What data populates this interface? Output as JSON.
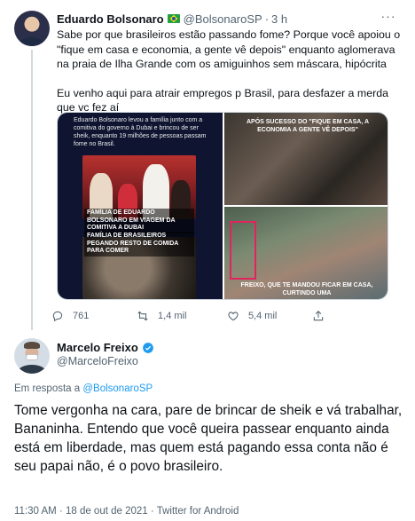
{
  "tweet1": {
    "author_name": "Eduardo Bolsonaro",
    "handle": "@BolsonaroSP",
    "separator": "·",
    "time": "3 h",
    "more": "···",
    "paragraph1": "Sabe por que brasileiros estão passando fome? Porque você apoiou o \"fique em casa e economia, a gente vê depois\" enquanto aglomerava na praia de Ilha Grande com os amiguinhos sem máscara, hipócrita",
    "paragraph2": "Eu venho aqui para atrair empregos p Brasil, para desfazer a merda que vc fez aí",
    "media": {
      "left_caption": "Eduardo Bolsonaro levou a família junto com a comitiva do governo à Dubai e brincou de ser sheik, enquanto 19 milhões de pessoas passam fome no Brasil.",
      "left_label_1": "FAMÍLIA DE EDUARDO BOLSONARO EM VIAGEM DA COMITIVA A DUBAI",
      "left_label_2": "FAMÍLIA DE BRASILEIROS PEGANDO RESTO DE COMIDA PARA COMER",
      "right_label_top": "APÓS SUCESSO DO \"FIQUE EM CASA, A ECONOMIA A GENTE VÊ DEPOIS\"",
      "right_label_bottom": "FREIXO, QUE TE MANDOU FICAR EM CASA, CURTINDO UMA"
    },
    "actions": {
      "replies": "761",
      "retweets": "1,4 mil",
      "likes": "5,4 mil"
    }
  },
  "tweet2": {
    "author_name": "Marcelo Freixo",
    "handle": "@MarceloFreixo",
    "reply_prefix": "Em resposta a",
    "reply_to": "@BolsonaroSP",
    "text": "Tome vergonha na cara, pare de brincar de sheik e vá trabalhar, Bananinha. Entendo que você queira passear enquanto ainda está em liberdade, mas quem está pagando essa conta não é seu papai não, é o povo brasileiro.",
    "meta": "11:30 AM · 18 de out de 2021 · Twitter for Android"
  },
  "colors": {
    "text": "#0f1419",
    "secondary": "#536471",
    "link": "#1d9bf0",
    "verified": "#1d9bf0",
    "border": "#cfd9de"
  }
}
